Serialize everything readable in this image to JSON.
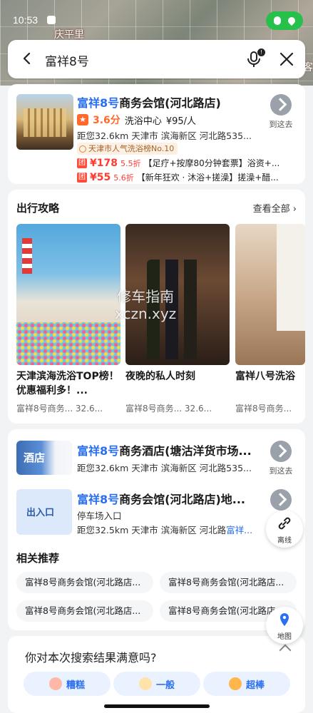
{
  "status_bar": {
    "time": "10:53"
  },
  "map": {
    "label_left": "庆平里",
    "label_right": "客"
  },
  "search": {
    "query": "富祥8号"
  },
  "hotel": {
    "title_highlight": "富祥8号",
    "title_rest": "商务会馆(河北路店)",
    "rating": "3.6分",
    "category": "洗浴中心",
    "avg_price": "¥95/人",
    "distance_line": "距您32.6km  天津市 滨海新区 河北路535...",
    "rank_tag": "天津市人气洗浴榜No.10",
    "deals": [
      {
        "tag": "团",
        "price": "¥178",
        "discount": "5.5折",
        "desc": "【足疗+按摩80分钟套票】浴资+..."
      },
      {
        "tag": "团",
        "price": "¥55",
        "discount": "5.6折",
        "desc": "【新年狂欢 · 沐浴+搓澡】搓澡+醋..."
      }
    ],
    "goto_label": "到这去"
  },
  "guides": {
    "section_title": "出行攻略",
    "see_all": "查看全部",
    "items": [
      {
        "title": "天津滨海洗浴TOP榜！优惠福利多！...",
        "source": "富祥8号商务...",
        "distance": "32.6..."
      },
      {
        "title": "夜晚的私人时刻",
        "source": "富祥8号商务...",
        "distance": "32.6..."
      },
      {
        "title": "富祥八号洗浴",
        "source": "富祥8号商务...",
        "distance": ""
      }
    ],
    "watermark_line1": "修车指南",
    "watermark_line2": "xczn.xyz"
  },
  "results": [
    {
      "image_label": "酒店",
      "title_highlight": "富祥8号",
      "title_rest": "商务酒店(塘沽洋货市场...",
      "meta": "距您32.6km  天津市 滨海新区 河北路535...",
      "goto_label": "到这去"
    },
    {
      "image_label": "出入口",
      "title_highlight": "富祥8号",
      "title_rest": "商务会馆(河北路店)地...",
      "subtitle": "停车场入口",
      "meta_prefix": "距您32.5km  天津市 滨海新区 河北路",
      "meta_highlight": "富祥..."
    }
  ],
  "related": {
    "title": "相关推荐",
    "chips": [
      "富祥8号商务会馆(河北路店...",
      "富祥8号商务会馆(河北路店...",
      "富祥8号商务会馆(河北路店...",
      "富祥8号商务会馆(河北路店..."
    ]
  },
  "feedback": {
    "question": "你对本次搜索结果满意吗?",
    "options": [
      "糟糕",
      "一般",
      "超棒"
    ]
  },
  "floating": {
    "line_label": "离线",
    "map_label": "地图"
  },
  "colors": {
    "accent": "#2a6ff0",
    "price": "#ff3b30",
    "rating": "#ff6a2c",
    "status_pill": "#27c04a"
  }
}
